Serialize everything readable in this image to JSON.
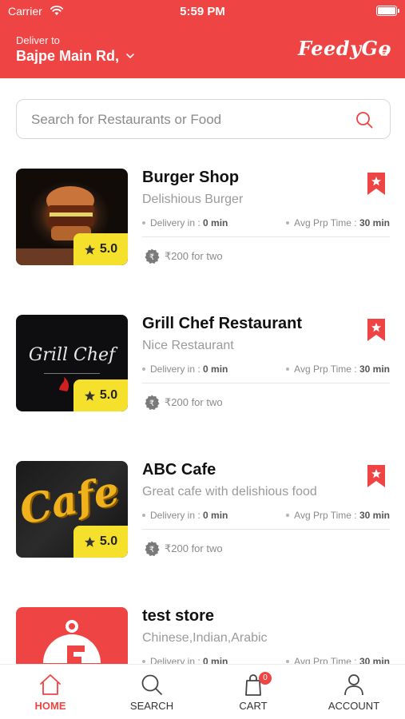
{
  "status_bar": {
    "carrier": "Carrier",
    "time": "5:59 PM"
  },
  "header": {
    "deliver_label": "Deliver to",
    "location": "Bajpe Main Rd,",
    "logo_text": "FeedyGo"
  },
  "search": {
    "placeholder": "Search for Restaurants or Food"
  },
  "restaurants": [
    {
      "name": "Burger Shop",
      "description": "Delishious Burger",
      "rating": "5.0",
      "delivery_label": "Delivery in :",
      "delivery_value": "0 min",
      "prep_label": "Avg Prp Time :",
      "prep_value": "30 min",
      "price": "₹200 for two",
      "image_text": ""
    },
    {
      "name": "Grill Chef Restaurant",
      "description": "Nice Restaurant",
      "rating": "5.0",
      "delivery_label": "Delivery in :",
      "delivery_value": "0 min",
      "prep_label": "Avg Prp Time :",
      "prep_value": "30 min",
      "price": "₹200 for two",
      "image_text": "Grill Chef"
    },
    {
      "name": "ABC Cafe",
      "description": "Great cafe with delishious food",
      "rating": "5.0",
      "delivery_label": "Delivery in :",
      "delivery_value": "0 min",
      "prep_label": "Avg Prp Time :",
      "prep_value": "30 min",
      "price": "₹200 for two",
      "image_text": "Cafe"
    },
    {
      "name": "test store",
      "description": "Chinese,Indian,Arabic",
      "rating": "",
      "delivery_label": "Delivery in :",
      "delivery_value": "0 min",
      "prep_label": "Avg Prp Time :",
      "prep_value": "30 min",
      "price": "",
      "image_text": ""
    }
  ],
  "nav": {
    "home": "HOME",
    "search": "SEARCH",
    "cart": "CART",
    "cart_count": "0",
    "account": "ACCOUNT"
  },
  "colors": {
    "brand": "#ef4444",
    "rating_bg": "#f5e12c"
  }
}
